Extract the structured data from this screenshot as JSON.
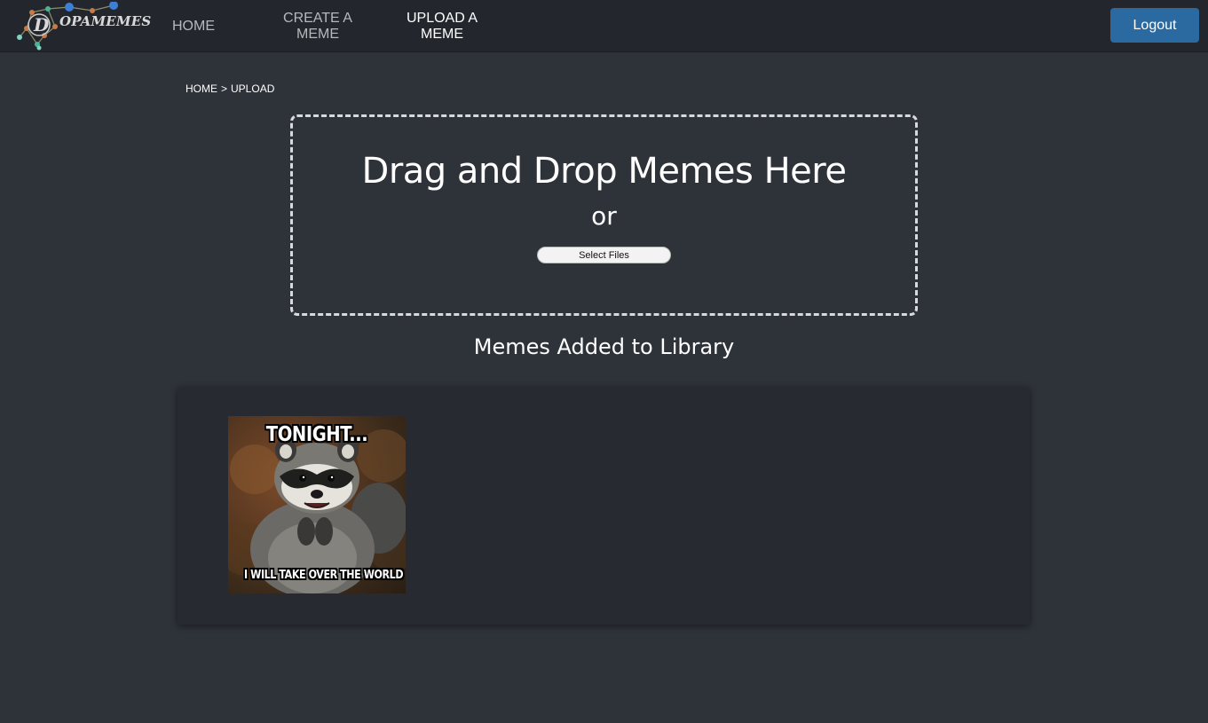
{
  "nav": {
    "logo_text": "OPAMEMES",
    "logo_letter": "D",
    "items": [
      {
        "label_line1": "HOME",
        "label_line2": ""
      },
      {
        "label_line1": "CREATE A",
        "label_line2": "MEME"
      },
      {
        "label_line1": "UPLOAD A",
        "label_line2": "MEME"
      }
    ],
    "logout_label": "Logout"
  },
  "breadcrumb": {
    "home": "HOME",
    "separator": ">",
    "current": "UPLOAD"
  },
  "dropzone": {
    "title": "Drag and Drop Memes Here",
    "or": "or",
    "select_files_label": "Select Files"
  },
  "library": {
    "title": "Memes Added to Library",
    "memes": [
      {
        "top_text": "TONIGHT...",
        "bottom_text": "I WILL TAKE OVER THE WORLD"
      }
    ]
  },
  "colors": {
    "background": "#2e333a",
    "navbar": "#23272d",
    "panel": "#272a30",
    "logout_button": "#2a6aa1",
    "active_nav": "#ffffff",
    "inactive_nav": "#b6b8bb"
  }
}
